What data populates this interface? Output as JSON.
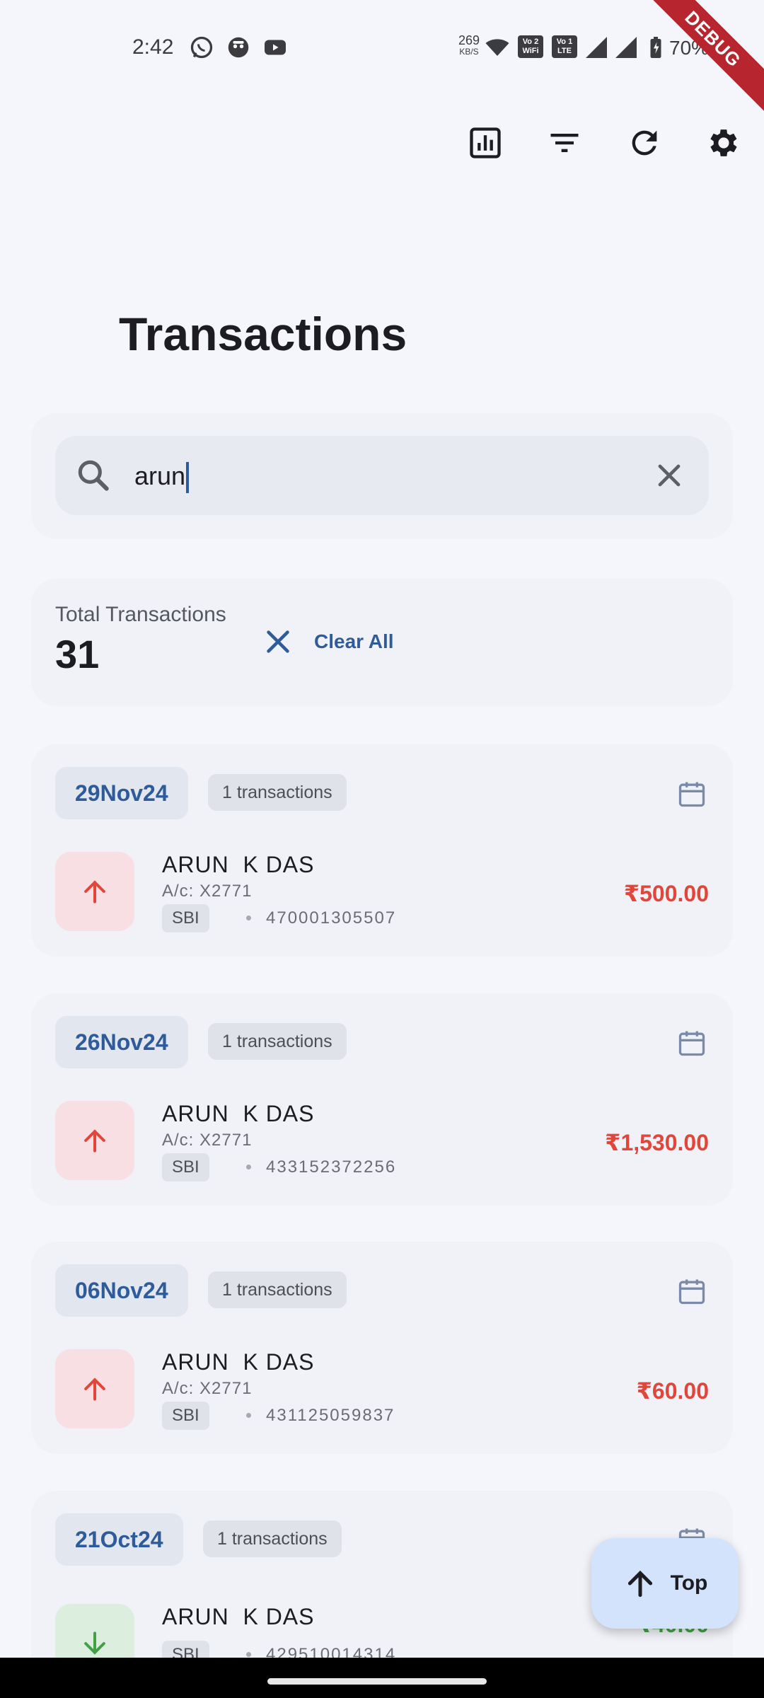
{
  "status_bar": {
    "time": "2:42",
    "net_speed": "269",
    "net_speed_unit": "KB/S",
    "chip_wifi": "Vo 2\nWiFi",
    "chip_lte": "Vo 1\nLTE",
    "battery": "70%",
    "icons": [
      "whatsapp-icon",
      "app-icon",
      "youtube-icon",
      "wifi-icon",
      "signal-icon",
      "signal-icon",
      "battery-charging-icon"
    ]
  },
  "debug_banner": "DEBUG",
  "toolbar": {
    "icons": [
      "analytics-icon",
      "filter-icon",
      "refresh-icon",
      "settings-icon"
    ]
  },
  "page": {
    "title": "Transactions"
  },
  "search": {
    "value": "arun",
    "icon": "search-icon",
    "clear_icon": "close-icon"
  },
  "summary": {
    "label": "Total Transactions",
    "count": "31",
    "clear_all": "Clear All"
  },
  "groups": [
    {
      "date": "29Nov24",
      "count_label": "1 transactions",
      "txn": {
        "direction": "debit",
        "name": "ARUN  K DAS",
        "account": "A/c: X2771",
        "bank": "SBI",
        "ref": "470001305507",
        "amount": "₹500.00"
      }
    },
    {
      "date": "26Nov24",
      "count_label": "1 transactions",
      "txn": {
        "direction": "debit",
        "name": "ARUN  K DAS",
        "account": "A/c: X2771",
        "bank": "SBI",
        "ref": "433152372256",
        "amount": "₹1,530.00"
      }
    },
    {
      "date": "06Nov24",
      "count_label": "1 transactions",
      "txn": {
        "direction": "debit",
        "name": "ARUN  K DAS",
        "account": "A/c: X2771",
        "bank": "SBI",
        "ref": "431125059837",
        "amount": "₹60.00"
      }
    },
    {
      "date": "21Oct24",
      "count_label": "1 transactions",
      "txn": {
        "direction": "credit",
        "name": "ARUN  K DAS",
        "account": "",
        "bank": "SBI",
        "ref": "429510014314",
        "amount": "₹40.00"
      }
    }
  ],
  "fab": {
    "label": "Top"
  },
  "colors": {
    "accent": "#2e5b9a",
    "debit": "#e0463a",
    "credit": "#43a047",
    "background": "#f5f6fb"
  }
}
